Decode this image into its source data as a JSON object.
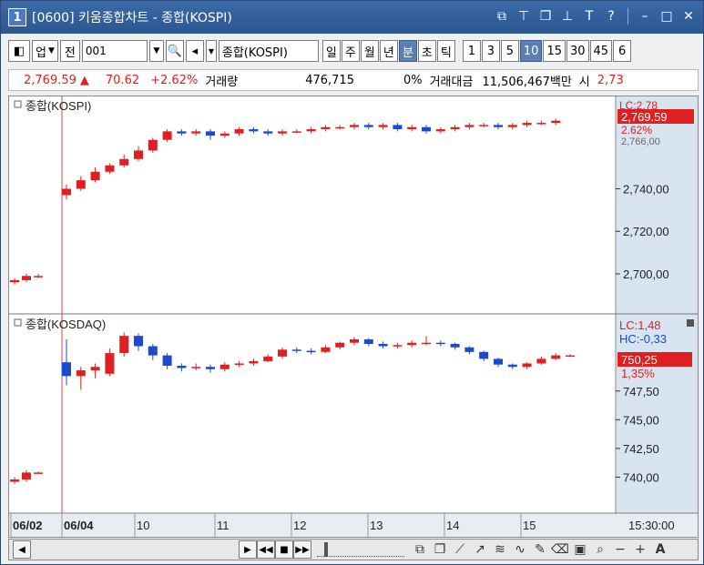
{
  "window": {
    "number": "1",
    "title": "[0600] 키움종합차트 - 종합(KOSPI)"
  },
  "toolbar": {
    "market_label": "업",
    "prev_label": "전",
    "code_value": "001",
    "name_value": "종합(KOSPI)",
    "periods": [
      "일",
      "주",
      "월",
      "년",
      "분",
      "초",
      "틱"
    ],
    "active_period": "분",
    "intervals": [
      "1",
      "3",
      "5",
      "10",
      "15",
      "30",
      "45",
      "6"
    ],
    "active_interval": "10"
  },
  "quote": {
    "price": "2,769.59",
    "arrow": "▲",
    "change": "70.62",
    "change_pct": "+2.62%",
    "volume_label": "거래량",
    "volume": "476,715",
    "volume_pct": "0%",
    "amount_label": "거래대금",
    "amount": "11,506,467백만",
    "extra_label": "시",
    "extra_value": "2,73"
  },
  "panels": [
    {
      "title": "종합(KOSPI)",
      "lc_label": "LC:2,78",
      "current": "2,769.59",
      "change_pct": "2.62%",
      "hc_label": "2,766,00",
      "ticks": [
        "2,740,00",
        "2,720,00",
        "2,700,00"
      ],
      "tick_values": [
        2740,
        2720,
        2700
      ],
      "range": [
        2685,
        2780
      ]
    },
    {
      "title": "종합(KOSDAQ)",
      "lc_label": "LC:1,48",
      "hc_label": "HC:-0,33",
      "current": "750,25",
      "change_pct": "1,35%",
      "ticks": [
        "747,50",
        "745,00",
        "742,50",
        "740,00"
      ],
      "tick_values": [
        747.5,
        745.0,
        742.5,
        740.0
      ],
      "range": [
        737.5,
        753.5
      ]
    }
  ],
  "x_axis": {
    "labels": [
      "06/02",
      "06/04",
      "10",
      "11",
      "12",
      "13",
      "14",
      "15"
    ],
    "time": "15:30:00"
  },
  "colors": {
    "up": "#e02020",
    "down": "#1a4ad0",
    "axis_bg": "#d8e4f0",
    "divider": "#e04040"
  },
  "chart_data": [
    {
      "type": "candlestick",
      "title": "종합(KOSPI)",
      "ylim": [
        2685,
        2780
      ],
      "candles": [
        {
          "o": 2696,
          "c": 2697,
          "h": 2698,
          "l": 2695
        },
        {
          "o": 2697,
          "c": 2699,
          "h": 2700,
          "l": 2696
        },
        {
          "o": 2699,
          "c": 2699,
          "h": 2700,
          "l": 2698
        },
        {
          "o": 2737,
          "c": 2740,
          "h": 2742,
          "l": 2735
        },
        {
          "o": 2740,
          "c": 2744,
          "h": 2746,
          "l": 2739
        },
        {
          "o": 2744,
          "c": 2748,
          "h": 2750,
          "l": 2743
        },
        {
          "o": 2748,
          "c": 2751,
          "h": 2752,
          "l": 2747
        },
        {
          "o": 2751,
          "c": 2754,
          "h": 2756,
          "l": 2750
        },
        {
          "o": 2754,
          "c": 2758,
          "h": 2760,
          "l": 2753
        },
        {
          "o": 2758,
          "c": 2763,
          "h": 2764,
          "l": 2757
        },
        {
          "o": 2763,
          "c": 2767,
          "h": 2768,
          "l": 2762
        },
        {
          "o": 2767,
          "c": 2766,
          "h": 2768,
          "l": 2765
        },
        {
          "o": 2766,
          "c": 2767,
          "h": 2768,
          "l": 2765
        },
        {
          "o": 2767,
          "c": 2765,
          "h": 2768,
          "l": 2763
        },
        {
          "o": 2765,
          "c": 2766,
          "h": 2767,
          "l": 2764
        },
        {
          "o": 2766,
          "c": 2768,
          "h": 2769,
          "l": 2765
        },
        {
          "o": 2768,
          "c": 2767,
          "h": 2769,
          "l": 2766
        },
        {
          "o": 2767,
          "c": 2766,
          "h": 2768,
          "l": 2765
        },
        {
          "o": 2766,
          "c": 2767,
          "h": 2768,
          "l": 2765
        },
        {
          "o": 2767,
          "c": 2767,
          "h": 2768,
          "l": 2766
        },
        {
          "o": 2767,
          "c": 2768,
          "h": 2769,
          "l": 2766
        },
        {
          "o": 2768,
          "c": 2769,
          "h": 2770,
          "l": 2767
        },
        {
          "o": 2769,
          "c": 2769,
          "h": 2770,
          "l": 2768
        },
        {
          "o": 2769,
          "c": 2770,
          "h": 2771,
          "l": 2768
        },
        {
          "o": 2770,
          "c": 2769,
          "h": 2771,
          "l": 2768
        },
        {
          "o": 2769,
          "c": 2770,
          "h": 2771,
          "l": 2768
        },
        {
          "o": 2770,
          "c": 2768,
          "h": 2771,
          "l": 2767
        },
        {
          "o": 2768,
          "c": 2769,
          "h": 2770,
          "l": 2767
        },
        {
          "o": 2769,
          "c": 2767,
          "h": 2770,
          "l": 2766
        },
        {
          "o": 2767,
          "c": 2768,
          "h": 2769,
          "l": 2766
        },
        {
          "o": 2768,
          "c": 2769,
          "h": 2770,
          "l": 2767
        },
        {
          "o": 2769,
          "c": 2770,
          "h": 2771,
          "l": 2768
        },
        {
          "o": 2770,
          "c": 2770,
          "h": 2771,
          "l": 2769
        },
        {
          "o": 2770,
          "c": 2769,
          "h": 2771,
          "l": 2768
        },
        {
          "o": 2769,
          "c": 2770,
          "h": 2771,
          "l": 2768
        },
        {
          "o": 2770,
          "c": 2771,
          "h": 2772,
          "l": 2769
        },
        {
          "o": 2771,
          "c": 2771,
          "h": 2772,
          "l": 2770
        },
        {
          "o": 2771,
          "c": 2772,
          "h": 2773,
          "l": 2770
        }
      ]
    },
    {
      "type": "candlestick",
      "title": "종합(KOSDAQ)",
      "ylim": [
        737.5,
        753.5
      ],
      "candles": [
        {
          "o": 739.6,
          "c": 739.8,
          "h": 740.0,
          "l": 739.4
        },
        {
          "o": 739.8,
          "c": 740.4,
          "h": 740.6,
          "l": 739.6
        },
        {
          "o": 740.4,
          "c": 740.4,
          "h": 740.5,
          "l": 740.3
        },
        {
          "o": 750.0,
          "c": 748.8,
          "h": 752.0,
          "l": 748.0
        },
        {
          "o": 748.8,
          "c": 749.3,
          "h": 749.6,
          "l": 747.6
        },
        {
          "o": 749.3,
          "c": 749.6,
          "h": 749.9,
          "l": 748.6
        },
        {
          "o": 749.0,
          "c": 750.8,
          "h": 751.2,
          "l": 748.8
        },
        {
          "o": 750.8,
          "c": 752.3,
          "h": 752.6,
          "l": 750.5
        },
        {
          "o": 752.3,
          "c": 751.4,
          "h": 752.5,
          "l": 751.0
        },
        {
          "o": 751.4,
          "c": 750.6,
          "h": 751.6,
          "l": 750.2
        },
        {
          "o": 750.6,
          "c": 749.7,
          "h": 750.8,
          "l": 749.4
        },
        {
          "o": 749.7,
          "c": 749.5,
          "h": 749.9,
          "l": 749.2
        },
        {
          "o": 749.5,
          "c": 749.6,
          "h": 749.9,
          "l": 749.3
        },
        {
          "o": 749.6,
          "c": 749.4,
          "h": 749.8,
          "l": 749.1
        },
        {
          "o": 749.4,
          "c": 749.8,
          "h": 750.0,
          "l": 749.2
        },
        {
          "o": 749.8,
          "c": 749.9,
          "h": 750.1,
          "l": 749.6
        },
        {
          "o": 749.9,
          "c": 750.1,
          "h": 750.3,
          "l": 749.7
        },
        {
          "o": 750.1,
          "c": 750.5,
          "h": 750.7,
          "l": 750.0
        },
        {
          "o": 750.5,
          "c": 751.1,
          "h": 751.3,
          "l": 750.3
        },
        {
          "o": 751.1,
          "c": 751.0,
          "h": 751.3,
          "l": 750.8
        },
        {
          "o": 751.0,
          "c": 750.9,
          "h": 751.2,
          "l": 750.7
        },
        {
          "o": 750.9,
          "c": 751.3,
          "h": 751.5,
          "l": 750.8
        },
        {
          "o": 751.3,
          "c": 751.7,
          "h": 751.8,
          "l": 751.1
        },
        {
          "o": 751.7,
          "c": 752.0,
          "h": 752.2,
          "l": 751.5
        },
        {
          "o": 752.0,
          "c": 751.6,
          "h": 752.1,
          "l": 751.4
        },
        {
          "o": 751.6,
          "c": 751.4,
          "h": 751.8,
          "l": 751.2
        },
        {
          "o": 751.4,
          "c": 751.5,
          "h": 751.7,
          "l": 751.2
        },
        {
          "o": 751.5,
          "c": 751.7,
          "h": 751.9,
          "l": 751.3
        },
        {
          "o": 751.7,
          "c": 751.7,
          "h": 752.3,
          "l": 751.5
        },
        {
          "o": 751.7,
          "c": 751.6,
          "h": 751.9,
          "l": 751.4
        },
        {
          "o": 751.6,
          "c": 751.3,
          "h": 751.7,
          "l": 751.1
        },
        {
          "o": 751.3,
          "c": 750.9,
          "h": 751.4,
          "l": 750.7
        },
        {
          "o": 750.9,
          "c": 750.3,
          "h": 751.0,
          "l": 750.1
        },
        {
          "o": 750.3,
          "c": 749.8,
          "h": 750.4,
          "l": 749.6
        },
        {
          "o": 749.8,
          "c": 749.6,
          "h": 749.9,
          "l": 749.4
        },
        {
          "o": 749.6,
          "c": 749.9,
          "h": 750.0,
          "l": 749.4
        },
        {
          "o": 749.9,
          "c": 750.3,
          "h": 750.5,
          "l": 749.8
        },
        {
          "o": 750.3,
          "c": 750.6,
          "h": 750.8,
          "l": 750.2
        },
        {
          "o": 750.6,
          "c": 750.6,
          "h": 750.7,
          "l": 750.5
        }
      ]
    }
  ]
}
